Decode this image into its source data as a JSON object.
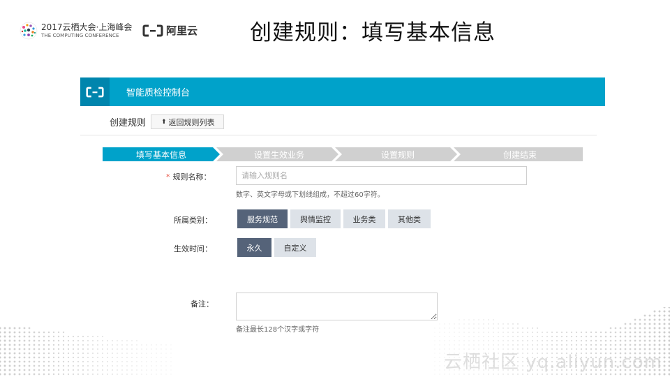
{
  "conference": {
    "title": "2017云栖大会·上海峰会",
    "subtitle": "THE COMPUTING CONFERENCE"
  },
  "brand": {
    "name": "阿里云"
  },
  "slide": {
    "title": "创建规则：填写基本信息"
  },
  "console": {
    "title": "智能质检控制台",
    "accent_color": "#00a2ca"
  },
  "breadcrumb": {
    "title": "创建规则",
    "back_label": "返回规则列表"
  },
  "steps": [
    {
      "label": "填写基本信息",
      "active": true
    },
    {
      "label": "设置生效业务",
      "active": false
    },
    {
      "label": "设置规则",
      "active": false
    },
    {
      "label": "创建结束",
      "active": false
    }
  ],
  "form": {
    "name": {
      "required_mark": "*",
      "label": "规则名称：",
      "placeholder": "请输入规则名",
      "value": "",
      "hint": "数字、英文字母或下划线组成，不超过60字符。"
    },
    "category": {
      "label": "所属类别：",
      "options": [
        "服务规范",
        "舆情监控",
        "业务类",
        "其他类"
      ],
      "selected": "服务规范"
    },
    "effective_time": {
      "label": "生效时间：",
      "options": [
        "永久",
        "自定义"
      ],
      "selected": "永久"
    },
    "remark": {
      "label": "备注：",
      "value": "",
      "hint": "备注最长128个汉字或字符"
    }
  },
  "watermark": "云栖社区 yq.aliyun.com"
}
